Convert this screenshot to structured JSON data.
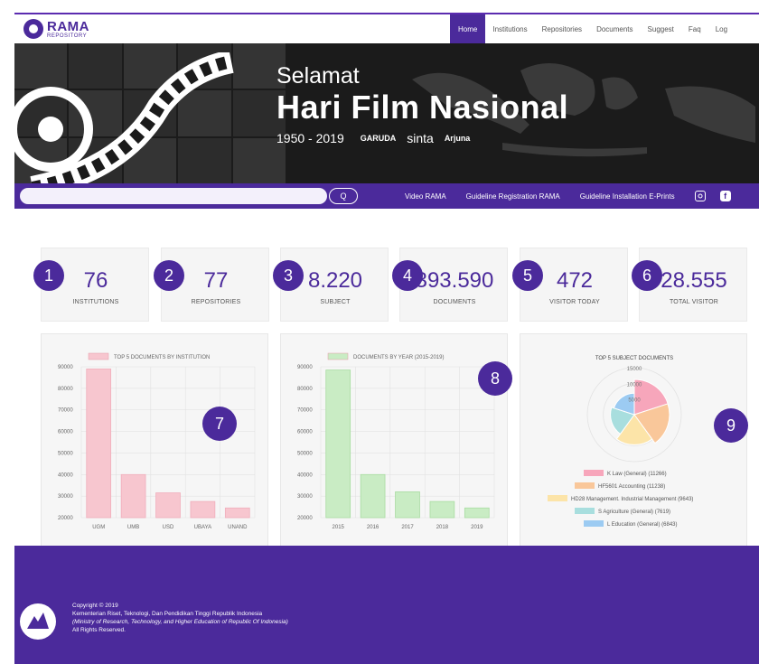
{
  "brand": {
    "name": "RAMA",
    "sub": "REPOSITORY"
  },
  "nav": {
    "items": [
      "Home",
      "Institutions",
      "Repositories",
      "Documents",
      "Suggest",
      "Faq",
      "Log"
    ]
  },
  "hero": {
    "line1": "Selamat",
    "line2": "Hari Film Nasional",
    "years": "1950 - 2019",
    "logos": [
      "GARUDA",
      "sinta",
      "Arjuna"
    ]
  },
  "searchbar": {
    "search_button": "Q",
    "links": [
      "Video RAMA",
      "Guideline Registration RAMA",
      "Guideline Installation E-Prints"
    ]
  },
  "stats": [
    {
      "badge": "1",
      "value": "76",
      "label": "INSTITUTIONS"
    },
    {
      "badge": "2",
      "value": "77",
      "label": "REPOSITORIES"
    },
    {
      "badge": "3",
      "value": "8.220",
      "label": "SUBJECT"
    },
    {
      "badge": "4",
      "value": "393.590",
      "label": "DOCUMENTS"
    },
    {
      "badge": "5",
      "value": "472",
      "label": "VISITOR TODAY"
    },
    {
      "badge": "6",
      "value": "28.555",
      "label": "TOTAL VISITOR"
    }
  ],
  "chart_badges": [
    "7",
    "8",
    "9"
  ],
  "chart_data": [
    {
      "type": "bar",
      "title": "TOP 5 DOCUMENTS BY INSTITUTION",
      "series": [
        {
          "name": "TOP 5 DOCUMENTS BY INSTITUTION",
          "values": [
            89000,
            40000,
            31500,
            27500,
            24500
          ]
        }
      ],
      "categories": [
        "UGM",
        "UMB",
        "USD",
        "UBAYA",
        "UNAND"
      ],
      "y_ticks": [
        "90000",
        "80000",
        "70000",
        "60000",
        "50000",
        "40000",
        "30000",
        "20000"
      ],
      "ylim": [
        20000,
        90000
      ],
      "color": "#f7c6cf"
    },
    {
      "type": "bar",
      "title": "DOCUMENTS BY YEAR (2015-2019)",
      "series": [
        {
          "name": "DOCUMENTS BY YEAR (2015-2019)",
          "values": [
            88500,
            40000,
            32000,
            27500,
            24500
          ]
        }
      ],
      "categories": [
        "2015",
        "2016",
        "2017",
        "2018",
        "2019"
      ],
      "y_ticks": [
        "90000",
        "80000",
        "70000",
        "60000",
        "50000",
        "40000",
        "30000",
        "20000"
      ],
      "ylim": [
        20000,
        90000
      ],
      "color": "#c9ecc4"
    },
    {
      "type": "pie",
      "title": "TOP 5 SUBJECT DOCUMENTS",
      "r_ticks": [
        "15000",
        "10000",
        "5000"
      ],
      "categories": [
        "K Law (General) (11266)",
        "HF5601 Accounting (11238)",
        "HD28 Management. Industrial Management (9643)",
        "S Agriculture (General) (7619)",
        "L Education (General) (6843)"
      ],
      "values": [
        11266,
        11238,
        9643,
        7619,
        6843
      ],
      "colors": [
        "#f7a6bb",
        "#f9c79a",
        "#fce4a8",
        "#a8dede",
        "#9ccbf2"
      ]
    }
  ],
  "footer": {
    "line1": "Copyright © 2019",
    "line2": "Kementerian Riset, Teknologi, Dan Pendidikan Tinggi Republik Indonesia",
    "line3": "(Ministry of Research, Technology, and Higher Education of Republic Of Indonesia)",
    "line4": "All Rights Reserved."
  }
}
